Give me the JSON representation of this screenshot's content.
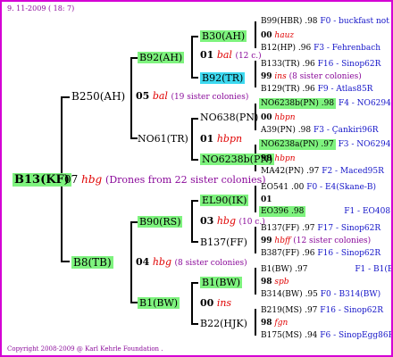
{
  "header_date": "9. 11-2009 ( 18: 7)",
  "footer": "Copyright 2008-2009 @ Karl Kehrle Foundation .",
  "root": {
    "id": "B13(KF)",
    "gen": "07",
    "breeder": "hbg",
    "note": "(Drones from 22 sister colonies)"
  },
  "sire_side": {
    "id": "B250(AH)",
    "gen": "05",
    "breeder": "bal",
    "note": "(19 sister colonies)",
    "a": {
      "id": "B92(AH)",
      "a": {
        "id": "B30(AH)",
        "gen": "01",
        "breeder": "bal",
        "note": "(12 c.)",
        "a": {
          "id": "B99(HBR)",
          "num": ".98",
          "info": "F0 - buckfast not"
        },
        "b": {
          "id": "00",
          "breeder": "hauz"
        },
        "c": {
          "id": "B12(HP)",
          "num": ".96",
          "info": "F3 - Fehrenbach"
        }
      },
      "b": {
        "id": "B92(TR)",
        "gen": "99",
        "breeder": "ins",
        "note": "(8 sister colonies)",
        "a": {
          "id": "B133(TR)",
          "num": ".96",
          "info": "F16 - Sinop62R"
        },
        "c": {
          "id": "B129(TR)",
          "num": ".96",
          "info": "F9 - Atlas85R"
        }
      }
    },
    "b": {
      "id": "NO61(TR)",
      "a": {
        "id": "NO638(PN)",
        "gen": "00",
        "breeder": "hbpn",
        "a": {
          "id": "NO6238b(PN)",
          "num": ".98",
          "info": "F4 - NO6294R"
        },
        "c": {
          "id": "A39(PN)",
          "num": ".98",
          "info": "F3 - Çankiri96R"
        }
      },
      "b": {
        "id": "NO6238b(PN)",
        "gen": "01",
        "breeder": "hbpn",
        "gen2": "98",
        "breeder2": "hbpn",
        "a": {
          "id": "NO6238a(PN)",
          "num": ".97",
          "info": "F3 - NO6294R"
        },
        "c": {
          "id": "MA42(PN)",
          "num": ".97",
          "info": "F2 - Maced95R"
        }
      }
    }
  },
  "dam_side": {
    "id": "B8(TB)",
    "gen": "04",
    "breeder": "hbg",
    "note": "(8 sister colonies)",
    "a": {
      "id": "B90(RS)",
      "a": {
        "id": "EL90(IK)",
        "gen": "01",
        "gen2": "03",
        "breeder2": "hbg",
        "note": "(10 c.)",
        "a": {
          "id": "EO541",
          "num": ".00",
          "info": "F0 - E4(Skane-B)"
        },
        "c": {
          "id": "EO396",
          "num": ".98",
          "info": "F1 - EO408"
        }
      },
      "b": {
        "id": "B137(FF)",
        "gen": "99",
        "breeder": "hbff",
        "note": "(12 sister colonies)",
        "a": {
          "id": "B137(FF)",
          "num": ".97",
          "info": "F17 - Sinop62R"
        },
        "c": {
          "id": "B387(FF)",
          "num": ".96",
          "info": "F16 - Sinop62R"
        }
      }
    },
    "b": {
      "id": "B1(BW)",
      "a": {
        "id": "B1(BW)",
        "gen": "98",
        "breeder": "spb",
        "gen2": "00",
        "breeder2": "ins",
        "a": {
          "id": "B1(BW)",
          "num": ".97",
          "info": "F1 - B1(BW)"
        },
        "c": {
          "id": "B314(BW)",
          "num": ".95",
          "info": "F0 - B314(BW)"
        }
      },
      "b": {
        "id": "B22(HJK)",
        "gen": "98",
        "breeder": "fgn",
        "a": {
          "id": "B219(MS)",
          "num": ".97",
          "info": "F16 - Sinop62R"
        },
        "c": {
          "id": "B175(MS)",
          "num": ".94",
          "info": "F6 - SinopEgg86R"
        }
      }
    }
  }
}
